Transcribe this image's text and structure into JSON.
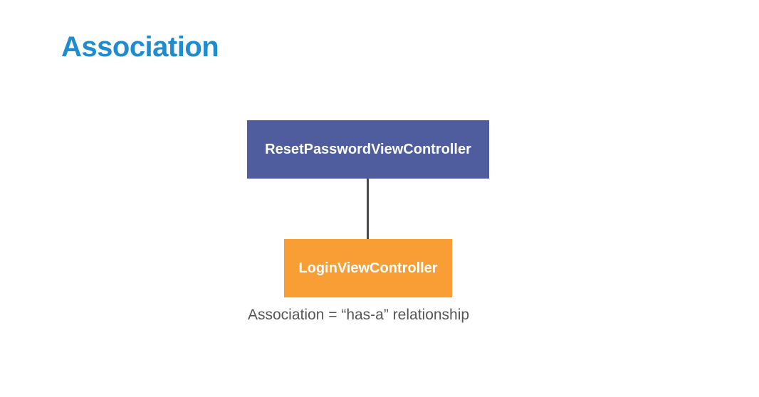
{
  "slide": {
    "title": "Association",
    "diagram": {
      "parent_class": "ResetPasswordViewController",
      "child_class": "LoginViewController",
      "caption": "Association = “has-a” relationship"
    }
  },
  "colors": {
    "title": "#1f8ccf",
    "parent_box": "#4f5d9f",
    "child_box": "#f99d35",
    "connector": "#4a4a4a",
    "caption_text": "#555555"
  }
}
